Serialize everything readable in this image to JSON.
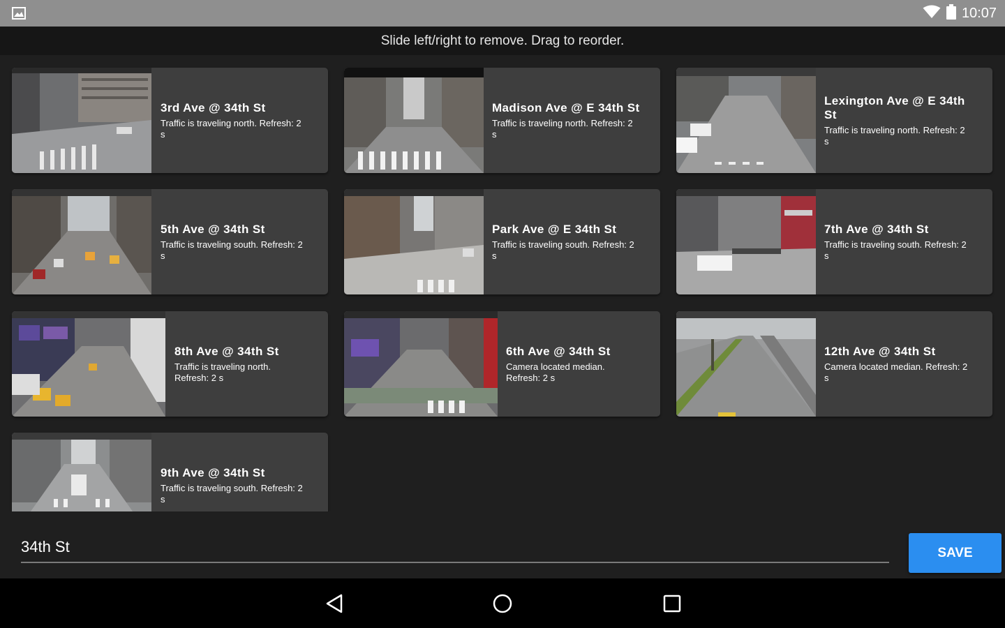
{
  "status_bar": {
    "time": "10:07",
    "icons": [
      "image-icon",
      "wifi-icon",
      "battery-icon"
    ]
  },
  "hint": "Slide left/right to remove. Drag to reorder.",
  "cameras": [
    {
      "title": "3rd Ave @ 34th St",
      "desc_lines": [
        "Traffic is traveling north. Refresh: 2",
        "s"
      ]
    },
    {
      "title": "Madison Ave @ E 34th St",
      "desc_lines": [
        "Traffic is traveling north. Refresh: 2",
        "s"
      ]
    },
    {
      "title_lines": [
        "Lexington Ave @ E 34th",
        "St"
      ],
      "desc_lines": [
        "Traffic is traveling north. Refresh: 2",
        "s"
      ]
    },
    {
      "title": "5th Ave @ 34th St",
      "desc_lines": [
        "Traffic is traveling south. Refresh: 2",
        "s"
      ]
    },
    {
      "title": "Park Ave @ E 34th St",
      "desc_lines": [
        "Traffic is traveling south. Refresh: 2",
        "s"
      ]
    },
    {
      "title": "7th Ave @ 34th St",
      "desc_lines": [
        "Traffic is traveling south. Refresh: 2",
        "s"
      ]
    },
    {
      "title": "8th Ave @ 34th St",
      "desc_lines": [
        "Traffic is traveling north.",
        "Refresh: 2 s"
      ]
    },
    {
      "title": "6th Ave @ 34th St",
      "desc_lines": [
        "Camera located median.",
        "Refresh: 2 s"
      ]
    },
    {
      "title": "12th Ave @ 34th St",
      "desc_lines": [
        "Camera located median. Refresh: 2",
        "s"
      ]
    },
    {
      "title": "9th Ave @ 34th St",
      "desc_lines": [
        "Traffic is traveling south. Refresh: 2",
        "s"
      ]
    }
  ],
  "name_field": {
    "value": "34th St"
  },
  "save_label": "SAVE",
  "nav": [
    "back-icon",
    "home-icon",
    "recents-icon"
  ],
  "colors": {
    "accent": "#2b8ef0",
    "card": "#3e3e3e",
    "background": "#1f1f1f",
    "status_bar": "#8f8f8f"
  }
}
